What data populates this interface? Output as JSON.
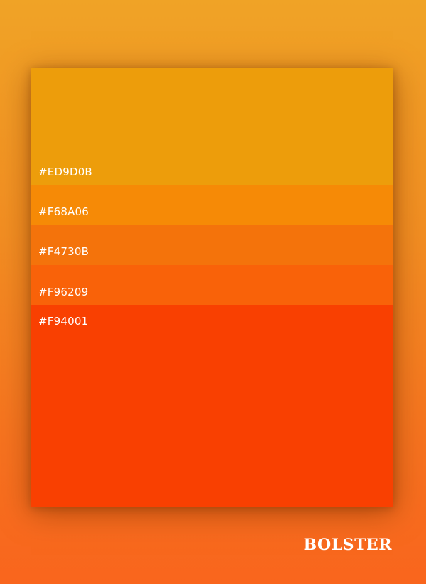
{
  "palette": {
    "swatches": [
      {
        "label": "#ED9D0B",
        "color": "#ED9D0B"
      },
      {
        "label": "#F68A06",
        "color": "#F68A06"
      },
      {
        "label": "#F4730B",
        "color": "#F4730B"
      },
      {
        "label": "#F96209",
        "color": "#F96209"
      },
      {
        "label": "#F94001",
        "color": "#F94001"
      }
    ]
  },
  "brand": {
    "name": "BOLSTER"
  }
}
